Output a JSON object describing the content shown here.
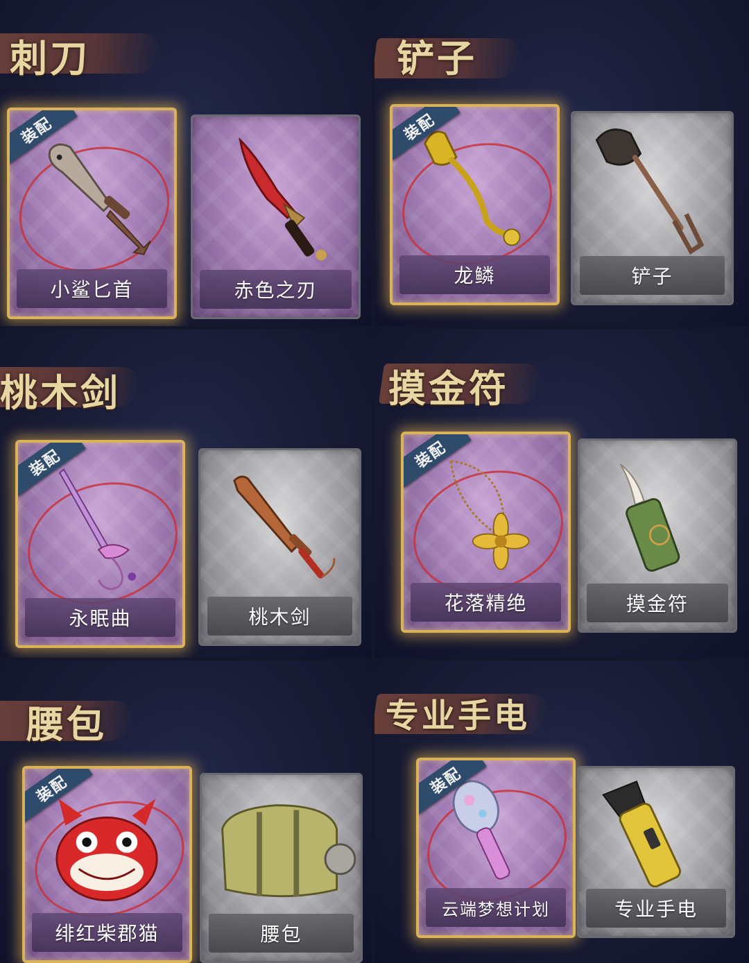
{
  "sections": [
    {
      "title": "刺刀",
      "cards": [
        {
          "name": "小鲨匕首",
          "rarity": "purple",
          "equipped": true,
          "badge": "装配"
        },
        {
          "name": "赤色之刃",
          "rarity": "purple",
          "equipped": false
        }
      ]
    },
    {
      "title": "铲子",
      "cards": [
        {
          "name": "龙鳞",
          "rarity": "purple",
          "equipped": true,
          "badge": "装配"
        },
        {
          "name": "铲子",
          "rarity": "grey",
          "equipped": false
        }
      ]
    },
    {
      "title": "桃木剑",
      "cards": [
        {
          "name": "永眠曲",
          "rarity": "purple",
          "equipped": true,
          "badge": "装配"
        },
        {
          "name": "桃木剑",
          "rarity": "grey",
          "equipped": false
        }
      ]
    },
    {
      "title": "摸金符",
      "cards": [
        {
          "name": "花落精绝",
          "rarity": "purple",
          "equipped": true,
          "badge": "装配"
        },
        {
          "name": "摸金符",
          "rarity": "grey",
          "equipped": false
        }
      ]
    },
    {
      "title": "腰包",
      "cards": [
        {
          "name": "绯红柴郡猫",
          "rarity": "purple",
          "equipped": true,
          "badge": "装配"
        },
        {
          "name": "腰包",
          "rarity": "grey",
          "equipped": false
        }
      ]
    },
    {
      "title": "专业手电",
      "cards": [
        {
          "name": "云端梦想计划",
          "rarity": "purple",
          "equipped": true,
          "badge": "装配"
        },
        {
          "name": "专业手电",
          "rarity": "grey",
          "equipped": false
        }
      ]
    }
  ],
  "colors": {
    "background": "#14172a",
    "title": "#e7d6a2",
    "equipped_border": "#d9b25a",
    "badge": "#2f4b6b"
  }
}
